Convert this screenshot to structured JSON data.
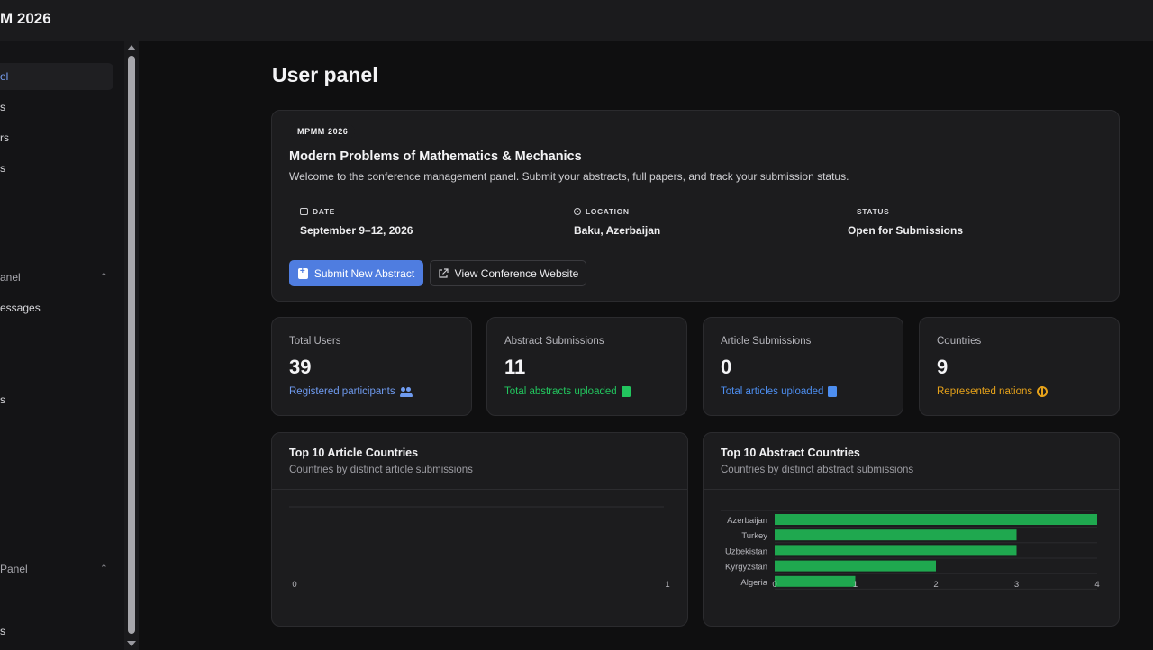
{
  "app": {
    "brand": "M 2026"
  },
  "sidebar": {
    "items": [
      {
        "label": "el"
      },
      {
        "label": "s"
      },
      {
        "label": "rs"
      },
      {
        "label": "s"
      }
    ],
    "sections": [
      {
        "label": "anel",
        "items": [
          {
            "label": "essages"
          },
          {
            "label": "s"
          }
        ]
      },
      {
        "label": " Panel",
        "items": [
          {
            "label": "s"
          }
        ]
      }
    ]
  },
  "page": {
    "title": "User panel"
  },
  "conference": {
    "tag": "MPMM 2026",
    "title": "Modern Problems of Mathematics & Mechanics",
    "description": "Welcome to the conference management panel. Submit your abstracts, full papers, and track your submission status.",
    "date_label": "DATE",
    "date": "September 9–12, 2026",
    "location_label": "LOCATION",
    "location": "Baku, Azerbaijan",
    "status_label": "STATUS",
    "status": "Open for Submissions",
    "primary_button": "Submit New Abstract",
    "secondary_button": "View Conference Website"
  },
  "stats": [
    {
      "label": "Total Users",
      "value": "39",
      "sub": "Registered participants",
      "color": "#6f9bf0",
      "icon": "users-icon"
    },
    {
      "label": "Abstract Submissions",
      "value": "11",
      "sub": "Total abstracts uploaded",
      "color": "#22c55e",
      "icon": "file-icon"
    },
    {
      "label": "Article Submissions",
      "value": "0",
      "sub": "Total articles uploaded",
      "color": "#4d8ef0",
      "icon": "file-icon"
    },
    {
      "label": "Countries",
      "value": "9",
      "sub": "Represented nations",
      "color": "#e6a21a",
      "icon": "globe-icon"
    }
  ],
  "chart_data": [
    {
      "type": "bar",
      "orientation": "horizontal",
      "title": "Top 10 Article Countries",
      "subtitle": "Countries by distinct article submissions",
      "categories": [],
      "values": [],
      "xlim": [
        0,
        1
      ],
      "xticks": [
        "0",
        "1"
      ]
    },
    {
      "type": "bar",
      "orientation": "horizontal",
      "title": "Top 10 Abstract Countries",
      "subtitle": "Countries by distinct abstract submissions",
      "categories": [
        "Azerbaijan",
        "Turkey",
        "Uzbekistan",
        "Kyrgyzstan",
        "Algeria"
      ],
      "values": [
        4,
        3,
        3,
        2,
        1
      ],
      "xlim": [
        0,
        4
      ],
      "xticks": [
        "0",
        "1",
        "2",
        "3",
        "4"
      ],
      "bar_color": "#1fa84f"
    }
  ]
}
